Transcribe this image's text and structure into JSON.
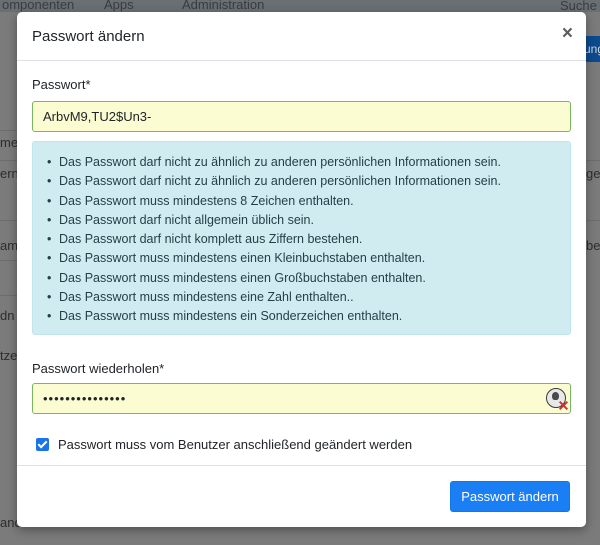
{
  "background": {
    "nav_items": [
      "omponenten",
      "Apps",
      "Administration"
    ],
    "search_label": "Suche",
    "button_fragment": "ung",
    "fragments": [
      "me",
      "ern",
      "ge",
      "am",
      "ber",
      "dn",
      "tzer",
      "and"
    ]
  },
  "modal": {
    "title": "Passwort ändern",
    "close_label": "×",
    "password_label": "Passwort*",
    "password_value": "ArbvM9,TU2$Un3-",
    "requirements": [
      "Das Passwort darf nicht zu ähnlich zu anderen persönlichen Informationen sein.",
      "Das Passwort darf nicht zu ähnlich zu anderen persönlichen Informationen sein.",
      "Das Passwort muss mindestens 8 Zeichen enthalten.",
      "Das Passwort darf nicht allgemein üblich sein.",
      "Das Passwort darf nicht komplett aus Ziffern bestehen.",
      "Das Passwort muss mindestens einen Kleinbuchstaben enthalten.",
      "Das Passwort muss mindestens einen Großbuchstaben enthalten.",
      "Das Passwort muss mindestens eine Zahl enthalten..",
      "Das Passwort muss mindestens ein Sonderzeichen enthalten."
    ],
    "repeat_label": "Passwort wiederholen*",
    "repeat_value": "•••••••••••••••",
    "repeat_icon": "password-manager-icon",
    "checkbox_label": "Passwort muss vom Benutzer anschließend geändert werden",
    "checkbox_checked": true,
    "submit_label": "Passwort ändern"
  },
  "colors": {
    "primary": "#1a7ef5",
    "alert_bg": "#d1ecf1",
    "input_bg": "#fcfcd2",
    "input_border": "#79b85e"
  }
}
